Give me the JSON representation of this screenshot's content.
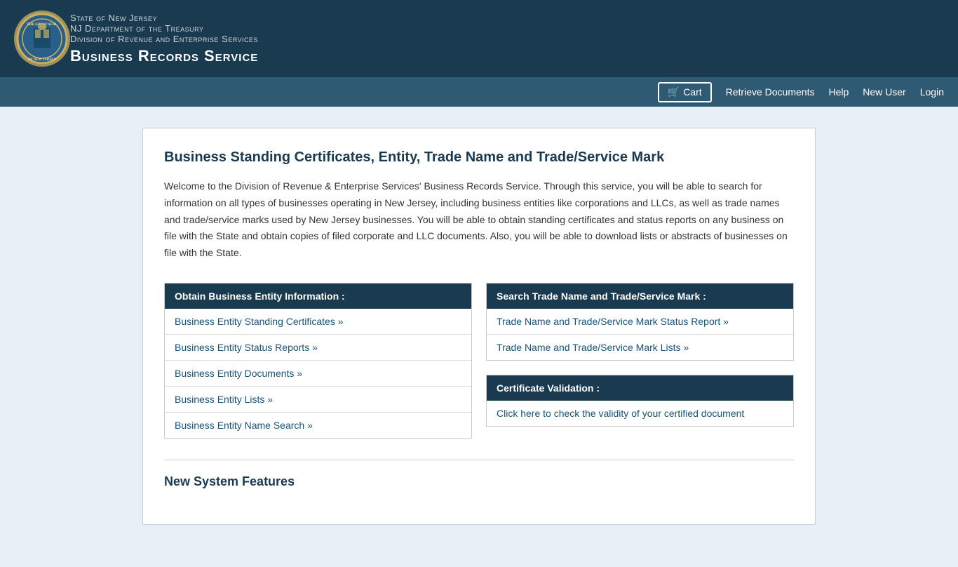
{
  "header": {
    "line1": "State of New Jersey",
    "line2": "NJ Department of the Treasury",
    "line3": "Division of Revenue and Enterprise Services",
    "line4": "Business Records Service",
    "seal_alt": "NJ State Seal"
  },
  "navbar": {
    "cart_label": "Cart",
    "cart_icon": "🛒",
    "links": [
      {
        "label": "Retrieve Documents",
        "href": "#"
      },
      {
        "label": "Help",
        "href": "#"
      },
      {
        "label": "New User",
        "href": "#"
      },
      {
        "label": "Login",
        "href": "#"
      }
    ]
  },
  "main": {
    "page_title": "Business Standing Certificates, Entity, Trade Name and Trade/Service Mark",
    "intro_text": "Welcome to the Division of Revenue & Enterprise Services' Business Records Service. Through this service, you will be able to search for information on all types of businesses operating in New Jersey, including business entities like corporations and LLCs, as well as trade names and trade/service marks used by New Jersey businesses. You will be able to obtain standing certificates and status reports on any business on file with the State and obtain copies of filed corporate and LLC documents. Also, you will be able to download lists or abstracts of businesses on file with the State.",
    "left_section": {
      "header": "Obtain Business Entity Information :",
      "links": [
        {
          "label": "Business Entity Standing Certificates »",
          "href": "#"
        },
        {
          "label": "Business Entity Status Reports »",
          "href": "#"
        },
        {
          "label": "Business Entity Documents »",
          "href": "#"
        },
        {
          "label": "Business Entity Lists »",
          "href": "#"
        },
        {
          "label": "Business Entity Name Search »",
          "href": "#"
        }
      ]
    },
    "right_top_section": {
      "header": "Search Trade Name and Trade/Service Mark :",
      "links": [
        {
          "label": "Trade Name and Trade/Service Mark Status Report »",
          "href": "#"
        },
        {
          "label": "Trade Name and Trade/Service Mark Lists »",
          "href": "#"
        }
      ]
    },
    "right_bottom_section": {
      "header": "Certificate Validation :",
      "links": [
        {
          "label": "Click here to check the validity of your certified document",
          "href": "#"
        }
      ]
    },
    "new_features_title": "New System Features"
  }
}
